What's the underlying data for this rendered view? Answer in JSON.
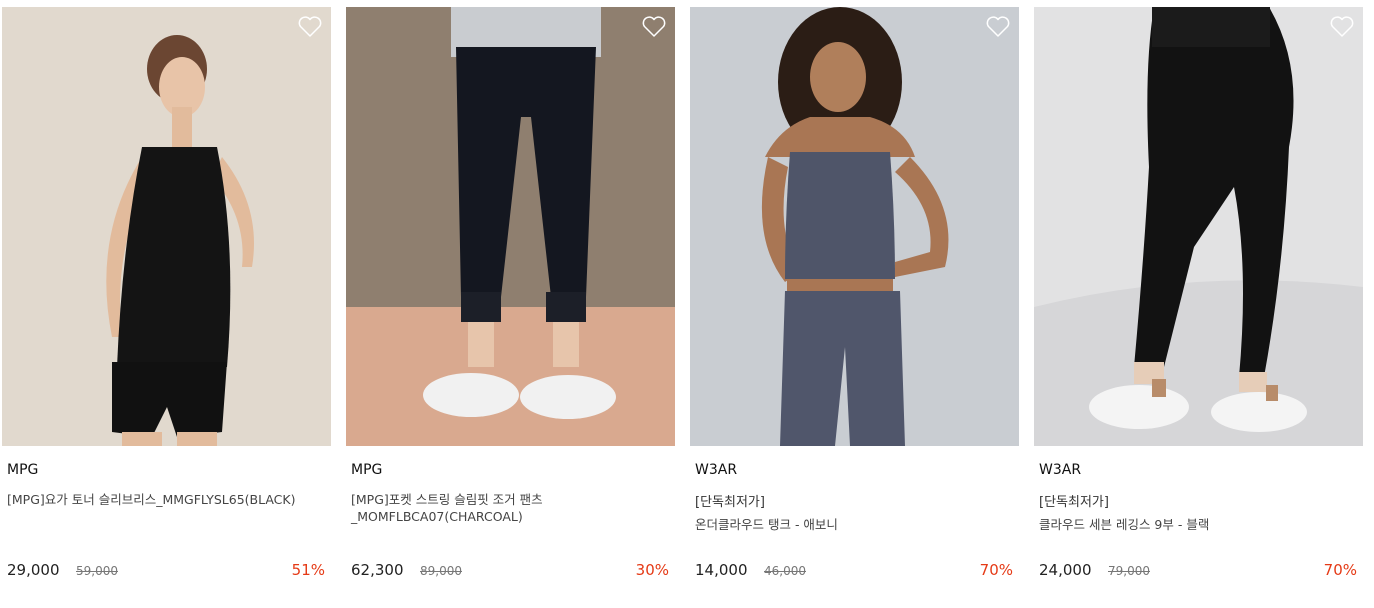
{
  "products": [
    {
      "brand": "MPG",
      "tag": "",
      "name": "[MPG]요가 토너 슬리브리스_MMGFLYSL65(BLACK)",
      "price": "29,000",
      "original_price": "59,000",
      "discount": "51%",
      "image": "woman-black-sleeveless-yoga-top-and-shorts",
      "wishlist_icon": "heart-outline-icon"
    },
    {
      "brand": "MPG",
      "tag": "",
      "name": "[MPG]포켓 스트링 슬림핏 조거 팬츠\n_MOMFLBCA07(CHARCOAL)",
      "price": "62,300",
      "original_price": "89,000",
      "discount": "30%",
      "image": "charcoal-jogger-pants-with-white-sneakers",
      "wishlist_icon": "heart-outline-icon"
    },
    {
      "brand": "W3AR",
      "tag": "[단독최저가]",
      "name": "온더클라우드 탱크 - 애보니",
      "price": "14,000",
      "original_price": "46,000",
      "discount": "70%",
      "image": "woman-navy-tank-top-and-leggings",
      "wishlist_icon": "heart-outline-icon"
    },
    {
      "brand": "W3AR",
      "tag": "[단독최저가]",
      "name": "클라우드 세븐 레깅스 9부 - 블랙",
      "price": "24,000",
      "original_price": "79,000",
      "discount": "70%",
      "image": "black-leggings-with-white-sneakers",
      "wishlist_icon": "heart-outline-icon"
    }
  ],
  "colors": {
    "discount": "#e53a16",
    "brand_text": "#111111",
    "name_text": "#444444",
    "strike_text": "#777777"
  }
}
